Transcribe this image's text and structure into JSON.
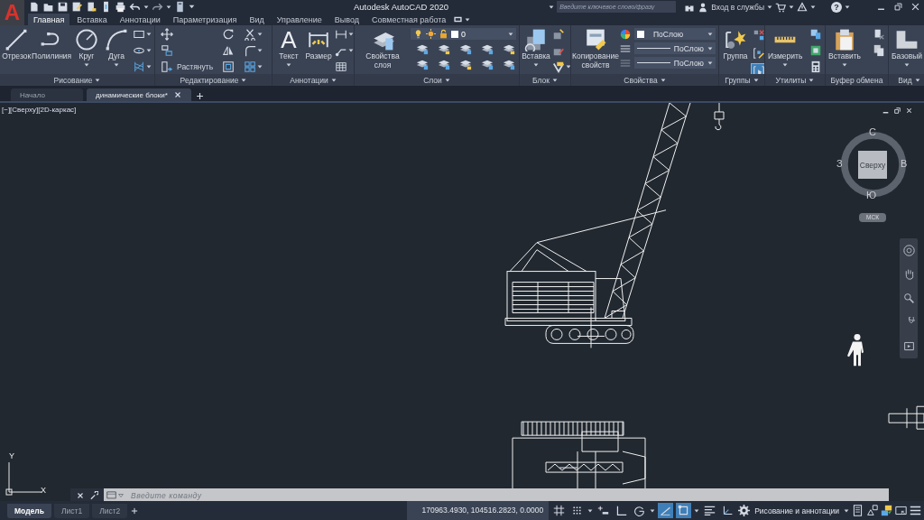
{
  "app_button": {
    "label": "A"
  },
  "window": {
    "title": "Autodesk AutoCAD 2020"
  },
  "search": {
    "placeholder": "Введите ключевое слово/фразу"
  },
  "account": {
    "label": "Вход в службы"
  },
  "help_button": {
    "label": "?"
  },
  "ribbon_tabs": [
    {
      "label": "Главная",
      "selected": true
    },
    {
      "label": "Вставка",
      "selected": false
    },
    {
      "label": "Аннотации",
      "selected": false
    },
    {
      "label": "Параметризация",
      "selected": false
    },
    {
      "label": "Вид",
      "selected": false
    },
    {
      "label": "Управление",
      "selected": false
    },
    {
      "label": "Вывод",
      "selected": false
    },
    {
      "label": "Совместная работа",
      "selected": false
    }
  ],
  "ribbon_panels": [
    {
      "kind": "draw",
      "title": "Рисование",
      "dropdown": true,
      "tools": [
        {
          "label": "Отрезок",
          "dropdown": false
        },
        {
          "label": "Полилиния",
          "dropdown": false
        },
        {
          "label": "Круг",
          "dropdown": true
        },
        {
          "label": "Дуга",
          "dropdown": true
        }
      ]
    },
    {
      "kind": "modify",
      "title": "Редактирование",
      "dropdown": true,
      "tools": [
        {
          "label": "Растянуть"
        }
      ]
    },
    {
      "kind": "annotate",
      "title": "Аннотации",
      "dropdown": true,
      "tools": [
        {
          "label": "Текст",
          "glyph": "A",
          "dropdown": true
        },
        {
          "label": "Размер",
          "dropdown": false
        }
      ]
    },
    {
      "kind": "layers",
      "title": "Слои",
      "dropdown": true,
      "layer": "0",
      "tools": [
        {
          "label": "Свойства слоя",
          "dropdown": false
        }
      ]
    },
    {
      "kind": "block",
      "title": "Блок",
      "dropdown": true,
      "tools": [
        {
          "label": "Вставка",
          "dropdown": true
        }
      ]
    },
    {
      "kind": "properties",
      "title": "Свойства",
      "dropdown": true,
      "fields": [
        "ПоСлою",
        "ПоСлою",
        "ПоСлою"
      ],
      "tools": [
        {
          "label": "Копирование свойств",
          "dropdown": false
        }
      ]
    },
    {
      "kind": "groups",
      "title": "Группы",
      "dropdown": true,
      "toggles": [
        {
          "on": false
        },
        {
          "on": false
        },
        {
          "on": true
        }
      ],
      "tools": [
        {
          "label": "Группа",
          "dropdown": false
        }
      ]
    },
    {
      "kind": "utilities",
      "title": "Утилиты",
      "dropdown": true,
      "tools": [
        {
          "label": "Измерить",
          "dropdown": true
        }
      ]
    },
    {
      "kind": "clipboard",
      "title": "Буфер обмена",
      "dropdown": false,
      "tools": [
        {
          "label": "Вставить",
          "dropdown": true
        }
      ]
    },
    {
      "kind": "view",
      "title": "Вид",
      "dropdown": true,
      "tools": [
        {
          "label": "Базовый",
          "dropdown": true
        }
      ]
    }
  ],
  "file_tabs": [
    {
      "label": "Начало",
      "selected": false,
      "closable": false
    },
    {
      "label": "динамические блоки*",
      "selected": true,
      "closable": true
    }
  ],
  "viewport": {
    "label": "[−][Сверху][2D-каркас]"
  },
  "viewcube": {
    "north": "С",
    "east": "В",
    "south": "Ю",
    "west": "З",
    "face": "Сверху",
    "ucs": "МСК"
  },
  "ucs_icon": {
    "y": "Y",
    "x": "X"
  },
  "command_line": {
    "placeholder": "Введите команду"
  },
  "layout_tabs": [
    {
      "label": "Модель",
      "selected": true
    },
    {
      "label": "Лист1",
      "selected": false
    },
    {
      "label": "Лист2",
      "selected": false
    }
  ],
  "status_bar": {
    "coordinates": "170963.4930, 104516.2823, 0.0000",
    "workspace": "Рисование и аннотации",
    "toggles": [
      {
        "kind": "grid",
        "on": false
      },
      {
        "kind": "snap",
        "on": false
      },
      {
        "kind": "infer",
        "on": false
      },
      {
        "kind": "ortho",
        "on": false
      },
      {
        "kind": "polar",
        "on": false
      },
      {
        "kind": "isodraft",
        "on": true
      },
      {
        "kind": "osnap",
        "on": true
      },
      {
        "kind": "lineweight",
        "on": false
      },
      {
        "kind": "ucs",
        "on": false
      }
    ]
  }
}
